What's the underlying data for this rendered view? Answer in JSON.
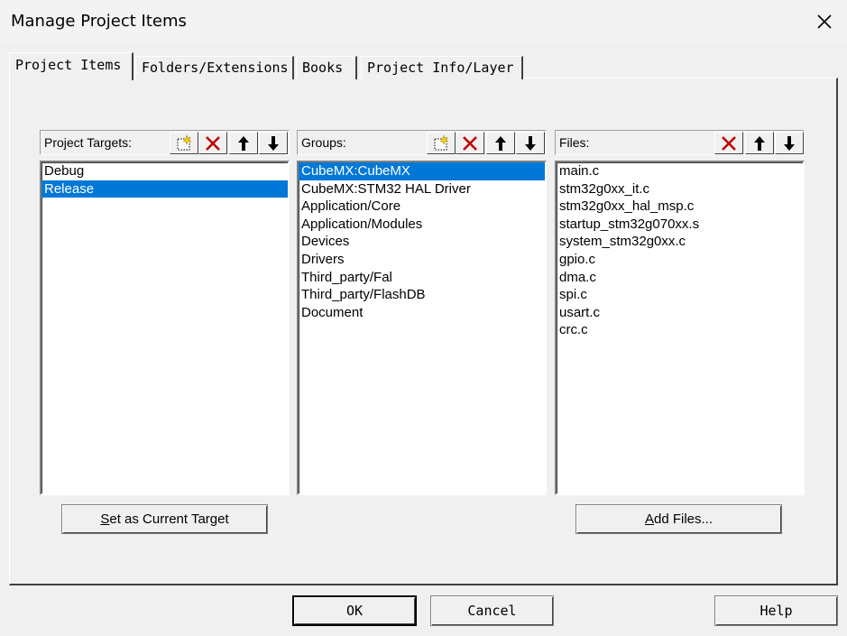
{
  "window": {
    "title": "Manage Project Items"
  },
  "tabs": [
    {
      "label": "Project Items"
    },
    {
      "label": "Folders/Extensions"
    },
    {
      "label": "Books"
    },
    {
      "label": "Project Info/Layer"
    }
  ],
  "targets": {
    "label": "Project Targets:",
    "items": [
      "Debug",
      "Release"
    ],
    "selected_index": 1,
    "set_current_pre": "",
    "set_current_mn": "S",
    "set_current_post": "et as Current Target"
  },
  "groups": {
    "label": "Groups:",
    "items": [
      "CubeMX:CubeMX",
      "CubeMX:STM32 HAL Driver",
      "Application/Core",
      "Application/Modules",
      "Devices",
      "Drivers",
      "Third_party/Fal",
      "Third_party/FlashDB",
      "Document"
    ],
    "selected_index": 0
  },
  "files": {
    "label": "Files:",
    "items": [
      "main.c",
      "stm32g0xx_it.c",
      "stm32g0xx_hal_msp.c",
      "startup_stm32g070xx.s",
      "system_stm32g0xx.c",
      "gpio.c",
      "dma.c",
      "spi.c",
      "usart.c",
      "crc.c"
    ],
    "add_pre": "",
    "add_mn": "A",
    "add_post": "dd Files..."
  },
  "footer": {
    "ok": "OK",
    "cancel": "Cancel",
    "help": "Help"
  },
  "icons": {
    "new": "new-item-icon",
    "delete": "delete-icon",
    "up": "move-up-icon",
    "down": "move-down-icon",
    "close": "close-icon"
  },
  "colors": {
    "selection": "#0078d7",
    "delete_red": "#c00000"
  }
}
